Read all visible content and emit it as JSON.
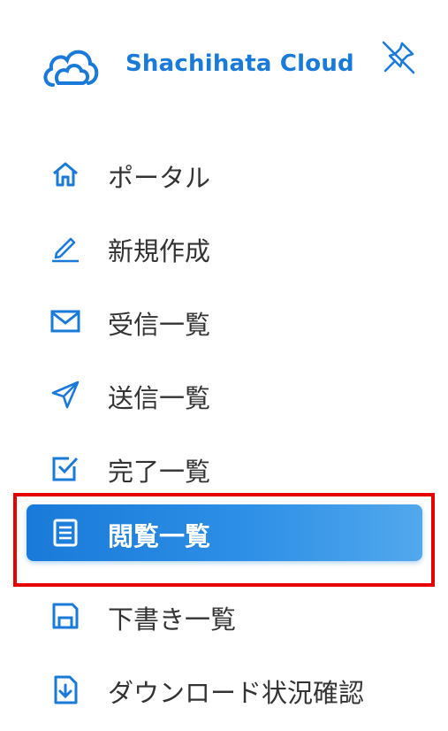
{
  "brand": {
    "name": "Shachihata Cloud"
  },
  "colors": {
    "accent": "#1a7ad9",
    "highlight": "#e60000",
    "text": "#333333"
  },
  "nav": {
    "items": [
      {
        "label": "ポータル",
        "icon": "home-icon"
      },
      {
        "label": "新規作成",
        "icon": "pen-icon"
      },
      {
        "label": "受信一覧",
        "icon": "mail-icon"
      },
      {
        "label": "送信一覧",
        "icon": "send-icon"
      },
      {
        "label": "完了一覧",
        "icon": "check-box-icon"
      },
      {
        "label": "閲覧一覧",
        "icon": "document-list-icon",
        "active": true
      },
      {
        "label": "下書き一覧",
        "icon": "save-icon"
      },
      {
        "label": "ダウンロード状況確認",
        "icon": "download-file-icon"
      }
    ]
  }
}
